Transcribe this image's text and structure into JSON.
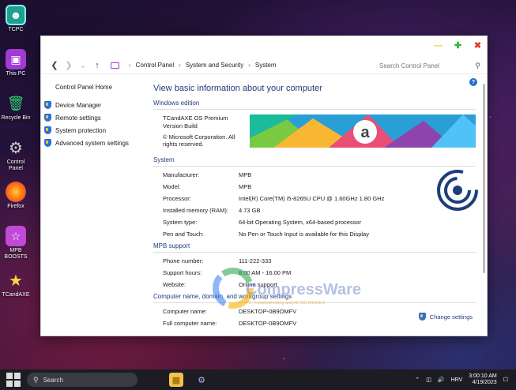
{
  "desktop": {
    "icons": [
      {
        "label": "TCPC",
        "icon": "tcpc-icon"
      },
      {
        "label": "This PC",
        "icon": "monitor-icon"
      },
      {
        "label": "Recycle Bin",
        "icon": "recycle-bin-icon"
      },
      {
        "label": "Control Panel",
        "icon": "gear-icon"
      },
      {
        "label": "Firefox",
        "icon": "firefox-icon"
      },
      {
        "label": "MPB BOOSTS",
        "icon": "boost-icon"
      },
      {
        "label": "TCandAXE",
        "icon": "star-icon"
      }
    ]
  },
  "window": {
    "breadcrumb": [
      "Control Panel",
      "System and Security",
      "System"
    ],
    "search_placeholder": "Search Control Panel",
    "left_pane": {
      "home": "Control Panel Home",
      "links": [
        "Device Manager",
        "Remote settings",
        "System protection",
        "Advanced system settings"
      ]
    },
    "main": {
      "heading": "View basic information about your computer",
      "edition_title": "Windows edition",
      "edition_name": "TCandAXE OS Premium",
      "edition_build": "Version Build",
      "edition_copyright": "© Microsoft Corporation. All rights reserved.",
      "system_title": "System",
      "system_rows": [
        {
          "k": "Manufacturer:",
          "v": "MPB"
        },
        {
          "k": "Model:",
          "v": "MPB"
        },
        {
          "k": "Processor:",
          "v": "Intel(R) Core(TM) i5-8265U CPU @ 1.60GHz   1.80 GHz"
        },
        {
          "k": "Installed memory (RAM):",
          "v": "4.73 GB"
        },
        {
          "k": "System type:",
          "v": "64-bit Operating System, x64-based processor"
        },
        {
          "k": "Pen and Touch:",
          "v": "No Pen or Touch Input is available for this Display"
        }
      ],
      "support_title": "MPB support",
      "support_rows": [
        {
          "k": "Phone number:",
          "v": "111-222-333"
        },
        {
          "k": "Support hours:",
          "v": "8.00 AM - 16.00 PM"
        },
        {
          "k": "Website:",
          "v": "Online support"
        }
      ],
      "computer_title": "Computer name, domain, and workgroup settings",
      "computer_rows": [
        {
          "k": "Computer name:",
          "v": "DESKTOP-0B9OMFV"
        },
        {
          "k": "Full computer name:",
          "v": "DESKTOP-0B9OMFV"
        }
      ],
      "change_settings": "Change settings",
      "watermark": "CompressWare",
      "watermark_sub": "PC Troubleshooting and All ISO IMAGES"
    }
  },
  "taskbar": {
    "search": "Search",
    "language": "HRV",
    "time": "3:00:10 AM",
    "date": "4/19/2023"
  }
}
